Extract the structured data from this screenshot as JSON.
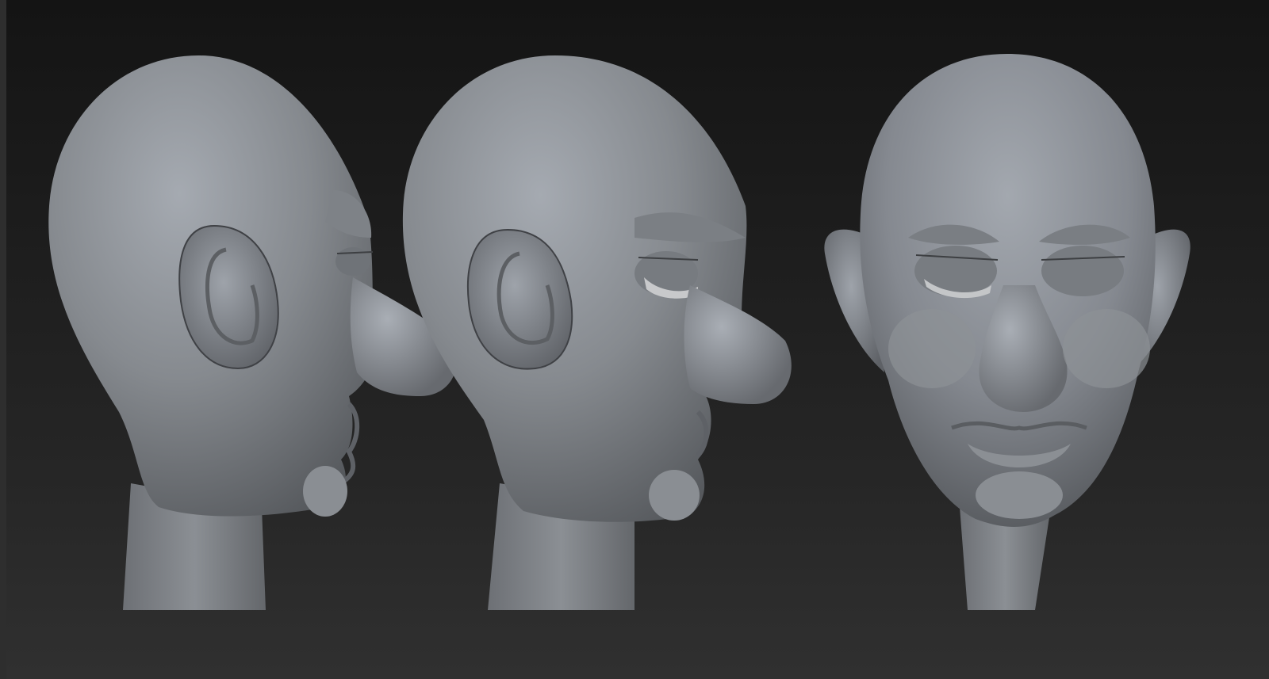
{
  "viewport": {
    "background_top": "#141414",
    "background_bottom": "#303030",
    "left_strip_color": "#2e2e2e"
  },
  "model": {
    "material_color": "#8a8e93",
    "highlight_color": "#b4b9c0",
    "shadow_color": "#5a5d61",
    "views": [
      "side-profile",
      "three-quarter",
      "front"
    ]
  }
}
